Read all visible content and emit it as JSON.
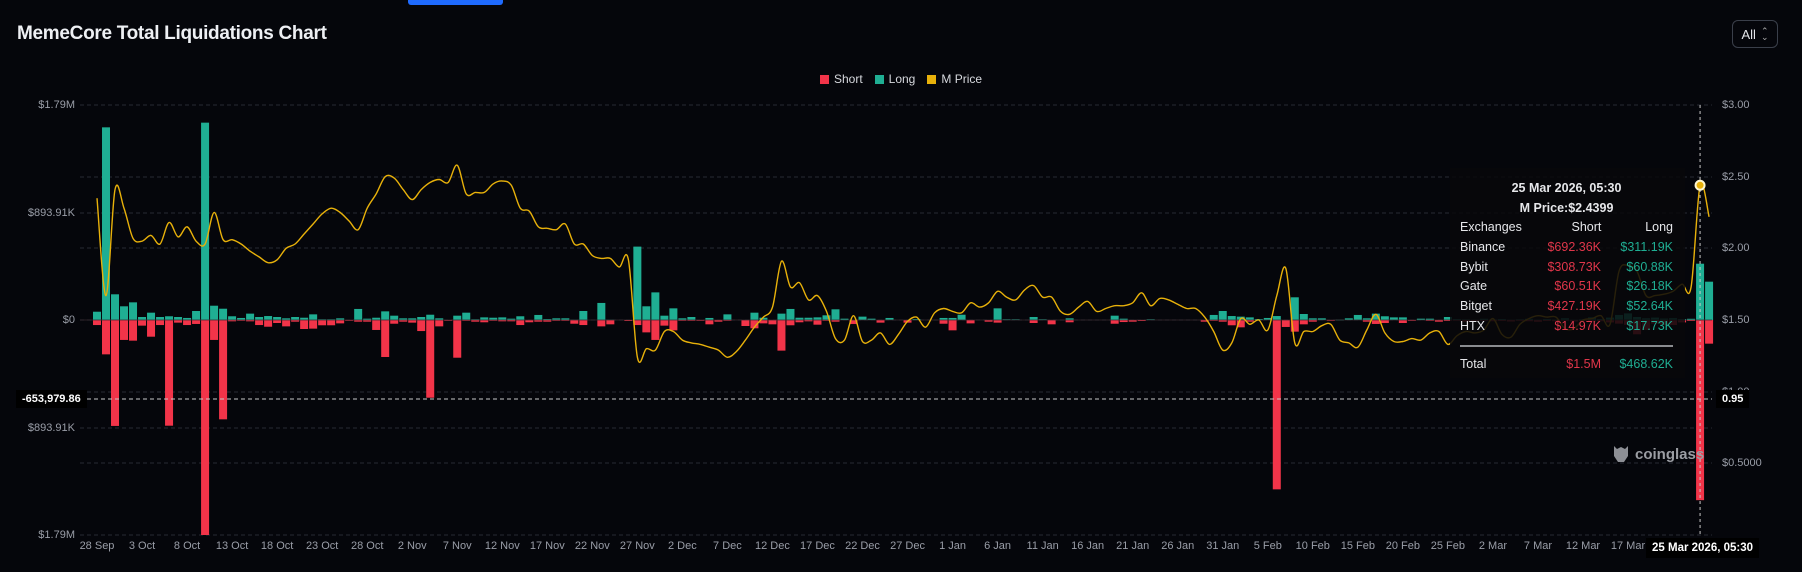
{
  "header": {
    "title": "MemeCore Total Liquidations Chart",
    "range_label": "All"
  },
  "colors": {
    "short": "#f23449",
    "long": "#1fae93",
    "price": "#e8b10a",
    "background": "#05060b",
    "accent": "#1f6bff"
  },
  "chart_data": {
    "type": "bar",
    "title": "MemeCore Total Liquidations Chart",
    "legend": [
      "Short",
      "Long",
      "M Price"
    ],
    "legend_position": "top-center",
    "grid": true,
    "left_axis": {
      "ticks": [
        "$1.79M",
        "$893.91K",
        "$0",
        "$893.91K",
        "$1.79M"
      ],
      "range_k": [
        -1790,
        1790
      ]
    },
    "right_axis": {
      "ticks": [
        "$3.00",
        "$2.50",
        "$2.00",
        "$1.50",
        "$1.00",
        "$0.5000"
      ],
      "range": [
        0,
        3
      ]
    },
    "x_tick_labels": [
      "28 Sep",
      "3 Oct",
      "8 Oct",
      "13 Oct",
      "18 Oct",
      "23 Oct",
      "28 Oct",
      "2 Nov",
      "7 Nov",
      "12 Nov",
      "17 Nov",
      "22 Nov",
      "27 Nov",
      "2 Dec",
      "7 Dec",
      "12 Dec",
      "17 Dec",
      "22 Dec",
      "27 Dec",
      "1 Jan",
      "6 Jan",
      "11 Jan",
      "16 Jan",
      "21 Jan",
      "26 Jan",
      "31 Jan",
      "5 Feb",
      "10 Feb",
      "15 Feb",
      "20 Feb",
      "25 Feb",
      "2 Mar",
      "7 Mar",
      "12 Mar",
      "17 Mar"
    ],
    "x_tick_every_days": 5,
    "series": [
      {
        "name": "Long",
        "unit": "K USD",
        "values": [
          69,
          1604,
          214,
          114,
          147,
          25,
          61,
          25,
          31,
          25,
          17,
          75,
          1643,
          119,
          94,
          31,
          17,
          53,
          25,
          33,
          25,
          14,
          25,
          19,
          47,
          6,
          6,
          14,
          0,
          92,
          11,
          19,
          72,
          36,
          14,
          14,
          25,
          44,
          14,
          0,
          36,
          61,
          6,
          22,
          19,
          22,
          11,
          31,
          0,
          42,
          8,
          14,
          14,
          3,
          75,
          0,
          142,
          3,
          0,
          0,
          611,
          114,
          230,
          36,
          97,
          14,
          25,
          0,
          17,
          0,
          47,
          0,
          0,
          61,
          19,
          0,
          53,
          92,
          19,
          19,
          22,
          39,
          89,
          11,
          0,
          28,
          11,
          0,
          17,
          0,
          0,
          8,
          0,
          0,
          17,
          17,
          44,
          0,
          0,
          0,
          97,
          6,
          6,
          0,
          25,
          6,
          0,
          0,
          14,
          0,
          0,
          0,
          0,
          36,
          11,
          0,
          0,
          6,
          0,
          0,
          0,
          0,
          0,
          0,
          42,
          75,
          33,
          28,
          22,
          8,
          17,
          33,
          0,
          189,
          50,
          14,
          14,
          0,
          3,
          14,
          42,
          14,
          53,
          31,
          22,
          22,
          0,
          11,
          11,
          0,
          25,
          8,
          6,
          3,
          10,
          5,
          8,
          3,
          6,
          10,
          3,
          8,
          5,
          14,
          3,
          6,
          22,
          8,
          20,
          42,
          55,
          25,
          14,
          20,
          12,
          15,
          8,
          10,
          468.62,
          319
        ]
      },
      {
        "name": "Short",
        "unit": "K USD",
        "values": [
          42,
          286,
          882,
          166,
          172,
          47,
          139,
          42,
          880,
          22,
          42,
          33,
          1790,
          166,
          827,
          11,
          6,
          11,
          42,
          56,
          25,
          53,
          14,
          75,
          72,
          44,
          44,
          28,
          6,
          14,
          14,
          83,
          308,
          31,
          14,
          22,
          92,
          647,
          53,
          3,
          314,
          6,
          14,
          19,
          6,
          11,
          11,
          42,
          19,
          14,
          14,
          6,
          6,
          31,
          42,
          0,
          53,
          36,
          0,
          8,
          42,
          103,
          166,
          47,
          86,
          6,
          6,
          3,
          36,
          14,
          6,
          0,
          50,
          69,
          28,
          36,
          255,
          44,
          19,
          11,
          39,
          6,
          14,
          0,
          33,
          0,
          0,
          22,
          0,
          0,
          22,
          0,
          0,
          0,
          31,
          86,
          0,
          28,
          0,
          14,
          22,
          0,
          0,
          0,
          25,
          0,
          36,
          0,
          19,
          0,
          0,
          0,
          0,
          31,
          17,
          14,
          8,
          0,
          0,
          0,
          0,
          0,
          0,
          14,
          6,
          14,
          44,
          61,
          14,
          0,
          0,
          1410,
          58,
          97,
          36,
          14,
          0,
          6,
          0,
          0,
          0,
          14,
          33,
          25,
          0,
          25,
          6,
          0,
          6,
          14,
          8,
          6,
          14,
          8,
          6,
          10,
          8,
          12,
          6,
          10,
          14,
          8,
          10,
          6,
          12,
          8,
          14,
          10,
          20,
          30,
          40,
          119,
          83,
          30,
          42,
          42,
          20,
          8,
          1500,
          197
        ]
      },
      {
        "name": "M Price",
        "unit": "USD",
        "values": [
          2.35,
          1.67,
          2.41,
          2.28,
          2.07,
          2.05,
          2.09,
          2.03,
          2.18,
          2.08,
          2.15,
          2.05,
          2.03,
          2.25,
          2.06,
          2.06,
          2.03,
          1.98,
          1.94,
          1.9,
          1.92,
          2.0,
          2.03,
          2.1,
          2.17,
          2.24,
          2.28,
          2.25,
          2.19,
          2.13,
          2.28,
          2.38,
          2.5,
          2.49,
          2.41,
          2.34,
          2.41,
          2.46,
          2.48,
          2.46,
          2.58,
          2.38,
          2.39,
          2.39,
          2.45,
          2.47,
          2.44,
          2.28,
          2.26,
          2.15,
          2.14,
          2.13,
          2.17,
          2.03,
          2.03,
          1.95,
          1.93,
          1.93,
          1.87,
          1.92,
          1.24,
          1.3,
          1.29,
          1.42,
          1.42,
          1.36,
          1.34,
          1.33,
          1.31,
          1.29,
          1.24,
          1.28,
          1.36,
          1.45,
          1.52,
          1.59,
          1.91,
          1.73,
          1.76,
          1.64,
          1.67,
          1.56,
          1.37,
          1.36,
          1.53,
          1.35,
          1.36,
          1.41,
          1.33,
          1.4,
          1.49,
          1.52,
          1.45,
          1.55,
          1.58,
          1.56,
          1.55,
          1.62,
          1.59,
          1.62,
          1.7,
          1.66,
          1.64,
          1.71,
          1.74,
          1.66,
          1.66,
          1.56,
          1.54,
          1.59,
          1.63,
          1.56,
          1.58,
          1.6,
          1.6,
          1.62,
          1.69,
          1.6,
          1.65,
          1.64,
          1.61,
          1.58,
          1.58,
          1.52,
          1.42,
          1.29,
          1.34,
          1.51,
          1.47,
          1.5,
          1.43,
          1.67,
          1.86,
          1.34,
          1.42,
          1.42,
          1.46,
          1.47,
          1.36,
          1.34,
          1.31,
          1.43,
          1.54,
          1.41,
          1.35,
          1.35,
          1.37,
          1.36,
          1.41,
          1.42,
          1.33,
          1.39,
          1.42,
          1.41,
          1.43,
          1.51,
          1.4,
          1.38,
          1.47,
          1.51,
          1.53,
          1.52,
          1.52,
          1.44,
          1.44,
          1.5,
          1.51,
          1.53,
          1.47,
          1.84,
          1.88,
          1.84,
          1.67,
          1.67,
          1.68,
          1.7,
          1.75,
          1.73,
          2.4399,
          2.22
        ]
      }
    ],
    "hover_index": 178
  },
  "crosshair": {
    "left_value": "-653,979.86",
    "right_value": "0.95",
    "x_label": "25 Mar 2026, 05:30"
  },
  "tooltip": {
    "date": "25 Mar 2026, 05:30",
    "price": "M Price:$2.4399",
    "headers": [
      "Exchanges",
      "Short",
      "Long"
    ],
    "rows": [
      {
        "exchange": "Binance",
        "short": "$692.36K",
        "long": "$311.19K"
      },
      {
        "exchange": "Bybit",
        "short": "$308.73K",
        "long": "$60.88K"
      },
      {
        "exchange": "Gate",
        "short": "$60.51K",
        "long": "$26.18K"
      },
      {
        "exchange": "Bitget",
        "short": "$427.19K",
        "long": "$52.64K"
      },
      {
        "exchange": "HTX",
        "short": "$14.97K",
        "long": "$17.73K"
      }
    ],
    "total": {
      "label": "Total",
      "short": "$1.5M",
      "long": "$468.62K"
    }
  },
  "watermark": "coinglass"
}
